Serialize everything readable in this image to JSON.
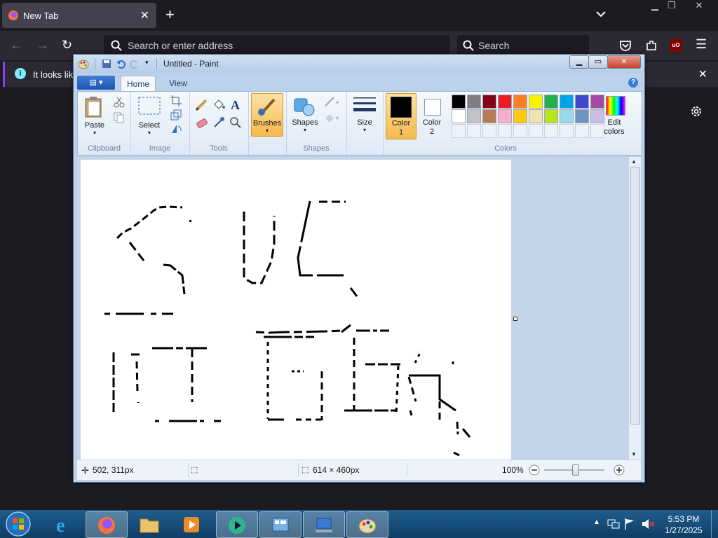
{
  "browser": {
    "tab_title": "New Tab",
    "url_placeholder": "Search or enter address",
    "search_placeholder": "Search",
    "notification_text": "It looks like"
  },
  "paint": {
    "window_title": "Untitled - Paint",
    "tabs": [
      "Home",
      "View"
    ],
    "groups": {
      "clipboard": "Clipboard",
      "image": "Image",
      "tools": "Tools",
      "shapes": "Shapes",
      "colors": "Colors"
    },
    "buttons": {
      "paste": "Paste",
      "select": "Select",
      "brushes": "Brushes",
      "shapes": "Shapes",
      "size": "Size",
      "color1_line1": "Color",
      "color1_line2": "1",
      "color2_line1": "Color",
      "color2_line2": "2",
      "edit_colors_line1": "Edit",
      "edit_colors_line2": "colors"
    },
    "palette_row1": [
      "#000000",
      "#7f7f7f",
      "#880015",
      "#ed1c24",
      "#ff7f27",
      "#fff200",
      "#22b14c",
      "#00a2e8",
      "#3f48cc",
      "#a349a4"
    ],
    "palette_row2": [
      "#ffffff",
      "#c3c3c3",
      "#b97a57",
      "#ffaec9",
      "#ffc90e",
      "#efe4b0",
      "#b5e61d",
      "#99d9ea",
      "#7092be",
      "#c8bfe7"
    ],
    "color1": "#000000",
    "color2": "#ffffff",
    "status": {
      "cursor": "502, 311px",
      "size": "614 × 460px",
      "zoom": "100%",
      "zoom_level": 1.0
    }
  },
  "taskbar": {
    "time": "5:53 PM",
    "date": "1/27/2025"
  }
}
